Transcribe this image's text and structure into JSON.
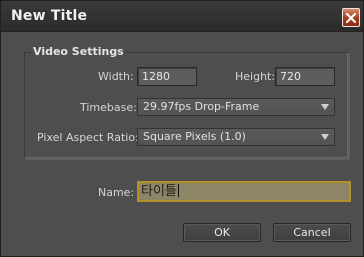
{
  "window": {
    "title": "New Title",
    "close_glyph": "X"
  },
  "video_settings": {
    "group_title": "Video Settings",
    "width_label": "Width:",
    "width_value": "1280",
    "height_label": "Height:",
    "height_value": "720",
    "timebase_label": "Timebase:",
    "timebase_value": "29.97fps Drop-Frame",
    "par_label": "Pixel Aspect Ratio:",
    "par_value": "Square Pixels (1.0)"
  },
  "name": {
    "label": "Name:",
    "value": "타이틀"
  },
  "buttons": {
    "ok": "OK",
    "cancel": "Cancel"
  },
  "colors": {
    "dialog_bg": "#4e4e4e",
    "close_button": "#a23a1f",
    "name_field_focus": "#b48f2a"
  }
}
